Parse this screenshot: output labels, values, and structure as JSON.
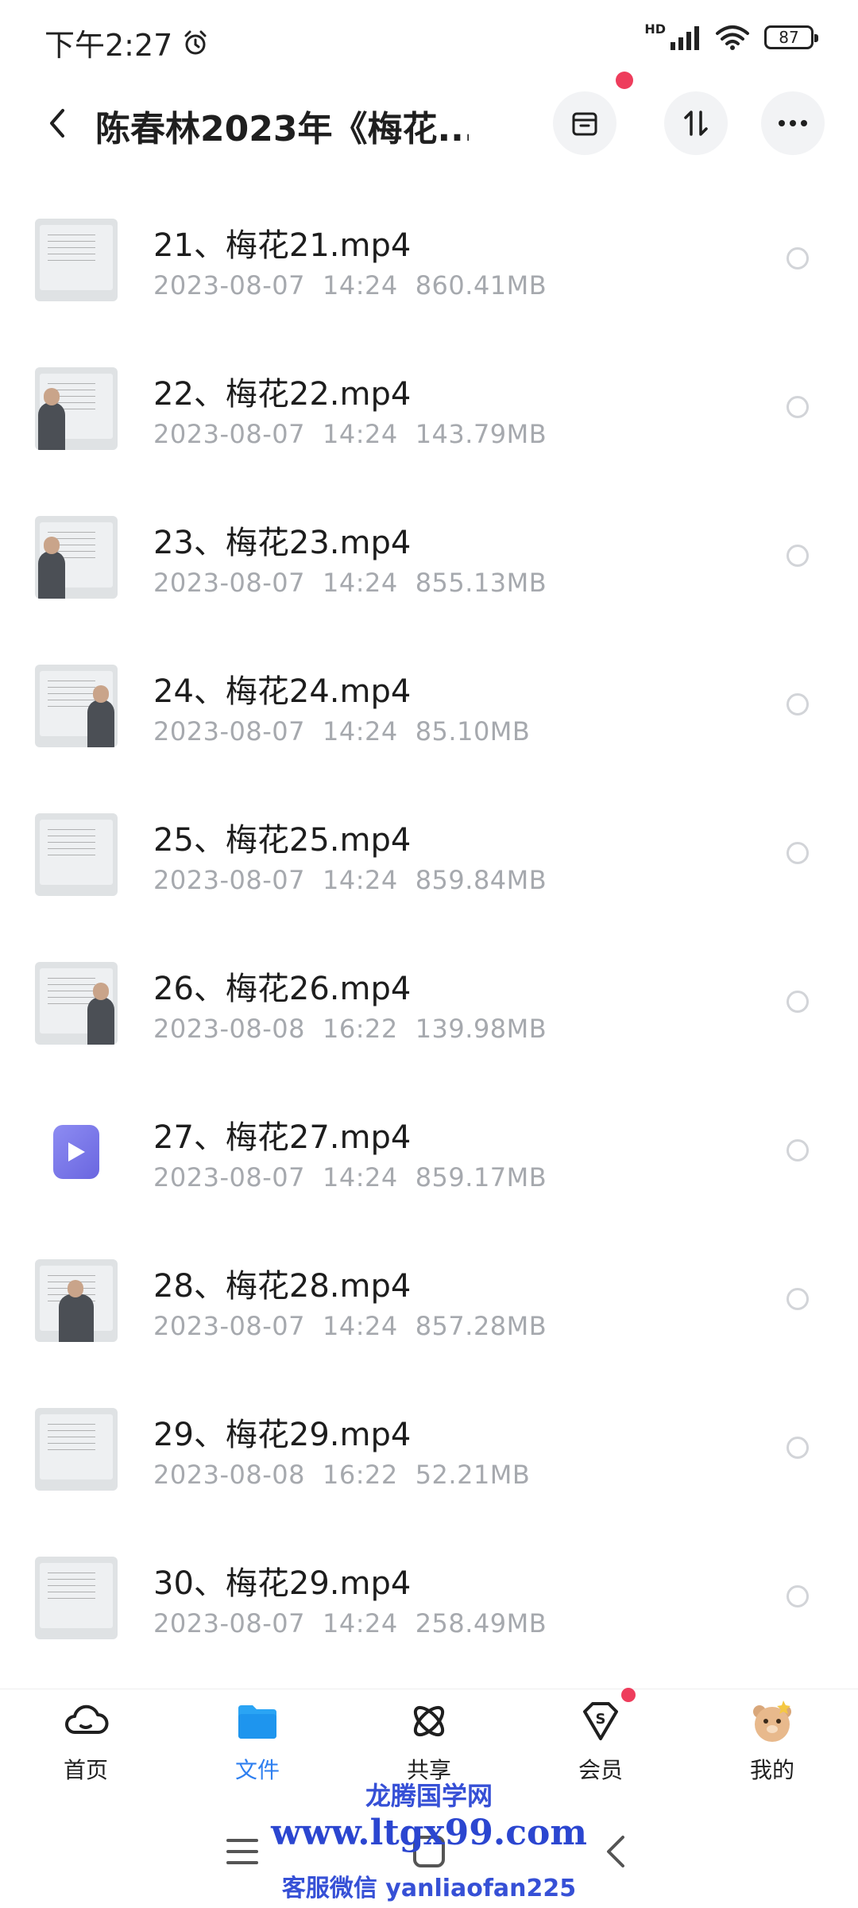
{
  "status_bar": {
    "time": "下午2:27",
    "network_label": "HD",
    "battery": "87"
  },
  "header": {
    "title": "陈春林2023年《梅花...",
    "icons": [
      "back-icon",
      "archive-icon",
      "sort-icon",
      "more-icon"
    ],
    "notification_dot_color": "#ee3d5c"
  },
  "files": [
    {
      "name": "21、梅花21.mp4",
      "date": "2023-08-07",
      "time": "14:24",
      "size": "860.41MB",
      "thumb": "whiteboard"
    },
    {
      "name": "22、梅花22.mp4",
      "date": "2023-08-07",
      "time": "14:24",
      "size": "143.79MB",
      "thumb": "whiteboard-person-left"
    },
    {
      "name": "23、梅花23.mp4",
      "date": "2023-08-07",
      "time": "14:24",
      "size": "855.13MB",
      "thumb": "whiteboard-person-left"
    },
    {
      "name": "24、梅花24.mp4",
      "date": "2023-08-07",
      "time": "14:24",
      "size": "85.10MB",
      "thumb": "whiteboard-person-right"
    },
    {
      "name": "25、梅花25.mp4",
      "date": "2023-08-07",
      "time": "14:24",
      "size": "859.84MB",
      "thumb": "whiteboard"
    },
    {
      "name": "26、梅花26.mp4",
      "date": "2023-08-08",
      "time": "16:22",
      "size": "139.98MB",
      "thumb": "whiteboard-person-right"
    },
    {
      "name": "27、梅花27.mp4",
      "date": "2023-08-07",
      "time": "14:24",
      "size": "859.17MB",
      "thumb": "video-icon"
    },
    {
      "name": "28、梅花28.mp4",
      "date": "2023-08-07",
      "time": "14:24",
      "size": "857.28MB",
      "thumb": "whiteboard-person-center"
    },
    {
      "name": "29、梅花29.mp4",
      "date": "2023-08-08",
      "time": "16:22",
      "size": "52.21MB",
      "thumb": "whiteboard"
    },
    {
      "name": "30、梅花29.mp4",
      "date": "2023-08-07",
      "time": "14:24",
      "size": "258.49MB",
      "thumb": "whiteboard"
    }
  ],
  "tabbar": {
    "tabs": [
      {
        "label": "首页",
        "icon": "cloud-home-icon"
      },
      {
        "label": "文件",
        "icon": "folder-icon",
        "active": true
      },
      {
        "label": "共享",
        "icon": "share-icon"
      },
      {
        "label": "会员",
        "icon": "vip-diamond-icon"
      },
      {
        "label": "我的",
        "icon": "avatar-icon"
      }
    ],
    "active_color": "#2e7ff0"
  },
  "watermark": {
    "line1": "龙腾国学网",
    "line2": "www.ltgx99.com",
    "line3": "客服微信 yanliaofan225"
  }
}
